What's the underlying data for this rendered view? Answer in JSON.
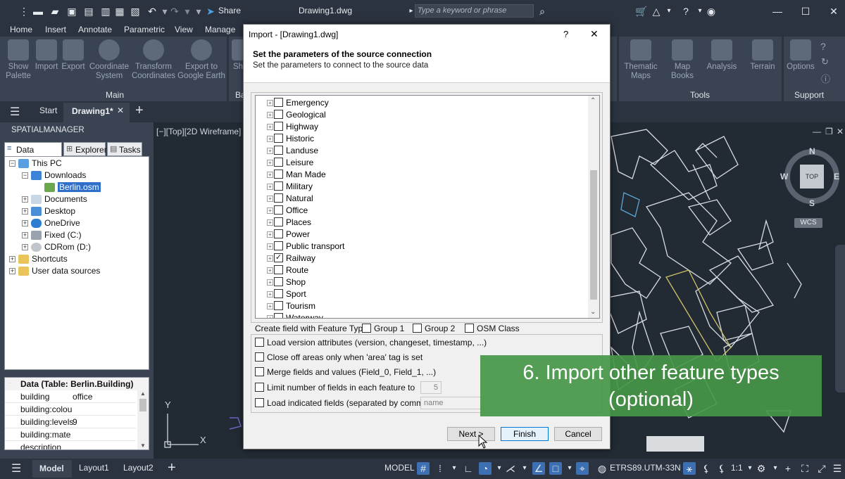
{
  "app": {
    "share_label": "Share",
    "doc_title": "Drawing1.dwg",
    "search_placeholder": "Type a keyword or phrase"
  },
  "menu": [
    "Home",
    "Insert",
    "Annotate",
    "Parametric",
    "View",
    "Manage"
  ],
  "ribbon": {
    "main_buttons": [
      {
        "label": "Show\nPalette",
        "icon": "spm-icon"
      },
      {
        "label": "Import",
        "icon": "import-icon"
      },
      {
        "label": "Export",
        "icon": "export-icon"
      },
      {
        "label": "Coordinate\nSystem",
        "icon": "globe-icon"
      },
      {
        "label": "Transform\nCoordinates",
        "icon": "transform-icon"
      },
      {
        "label": "Export to\nGoogle Earth",
        "icon": "google-earth-icon"
      }
    ],
    "partial_button": "Sh",
    "tools_buttons": [
      {
        "label": "Thematic\nMaps",
        "icon": "thematic-icon"
      },
      {
        "label": "Map\nBooks",
        "icon": "mapbook-icon"
      },
      {
        "label": "Analysis",
        "icon": "analysis-icon"
      },
      {
        "label": "Terrain",
        "icon": "terrain-icon"
      }
    ],
    "support_buttons": [
      {
        "label": "Options",
        "icon": "options-icon"
      }
    ],
    "group_main": "Main",
    "group_partial": "Ba",
    "group_tools": "Tools",
    "group_support": "Support"
  },
  "doc_tabs": {
    "start": "Start",
    "active": "Drawing1*"
  },
  "panel": {
    "title": "SPATIALMANAGER",
    "tabs": [
      "Data sources",
      "Explorer",
      "Tasks"
    ],
    "tree": [
      {
        "label": "This PC",
        "indent": 0,
        "icon": "pc"
      },
      {
        "label": "Downloads",
        "indent": 1,
        "icon": "download"
      },
      {
        "label": "Berlin.osm",
        "indent": 2,
        "icon": "osm",
        "selected": true
      },
      {
        "label": "Documents",
        "indent": 1,
        "icon": "doc"
      },
      {
        "label": "Desktop",
        "indent": 1,
        "icon": "desktop"
      },
      {
        "label": "OneDrive",
        "indent": 1,
        "icon": "cloud"
      },
      {
        "label": "Fixed (C:)",
        "indent": 1,
        "icon": "drive"
      },
      {
        "label": "CDRom (D:)",
        "indent": 1,
        "icon": "cd"
      },
      {
        "label": "Shortcuts",
        "indent": 0,
        "icon": "folder"
      },
      {
        "label": "User data sources",
        "indent": 0,
        "icon": "folder-user"
      }
    ],
    "data_header": "Data (Table: Berlin.Building)",
    "data_rows": [
      {
        "key": "building",
        "value": "office"
      },
      {
        "key": "building:colou",
        "value": ""
      },
      {
        "key": "building:levels",
        "value": "9"
      },
      {
        "key": "building:mate",
        "value": ""
      },
      {
        "key": "description",
        "value": ""
      }
    ]
  },
  "viewport": {
    "label": "[−][Top][2D Wireframe]",
    "compass": {
      "n": "N",
      "s": "S",
      "e": "E",
      "w": "W",
      "top": "TOP",
      "wcs": "WCS"
    },
    "axis_y": "Y",
    "axis_x": "X"
  },
  "dialog": {
    "title": "Import - [Drawing1.dwg]",
    "help": "?",
    "close": "✕",
    "heading": "Set the parameters of the source connection",
    "subheading": "Set the parameters to connect to the source data",
    "features": [
      {
        "label": "Emergency",
        "checked": false
      },
      {
        "label": "Geological",
        "checked": false
      },
      {
        "label": "Highway",
        "checked": false
      },
      {
        "label": "Historic",
        "checked": false
      },
      {
        "label": "Landuse",
        "checked": false
      },
      {
        "label": "Leisure",
        "checked": false
      },
      {
        "label": "Man Made",
        "checked": false
      },
      {
        "label": "Military",
        "checked": false
      },
      {
        "label": "Natural",
        "checked": false
      },
      {
        "label": "Office",
        "checked": false
      },
      {
        "label": "Places",
        "checked": false
      },
      {
        "label": "Power",
        "checked": false
      },
      {
        "label": "Public transport",
        "checked": false
      },
      {
        "label": "Railway",
        "checked": true
      },
      {
        "label": "Route",
        "checked": false
      },
      {
        "label": "Shop",
        "checked": false
      },
      {
        "label": "Sport",
        "checked": false
      },
      {
        "label": "Tourism",
        "checked": false
      },
      {
        "label": "Waterway",
        "checked": false
      }
    ],
    "create_field_label": "Create field with Feature Type",
    "group1": "Group 1",
    "group2": "Group 2",
    "osm_class": "OSM Class",
    "opt_version": "Load version attributes (version, changeset, timestamp, ...)",
    "opt_close": "Close off areas only when 'area' tag is set",
    "opt_merge": "Merge fields and values (Field_0, Field_1, ...)",
    "opt_limit": "Limit number of fields in each feature to",
    "limit_value": "5",
    "opt_indicated": "Load indicated fields (separated by commas)",
    "indicated_placeholder": "name",
    "btn_next": "Next >",
    "btn_finish": "Finish",
    "btn_cancel": "Cancel"
  },
  "caption": {
    "line1": "6. Import other feature types",
    "line2": "(optional)"
  },
  "status": {
    "model_tab": "Model",
    "layout1": "Layout1",
    "layout2": "Layout2",
    "model_button": "MODEL",
    "crs": "ETRS89.UTM-33N",
    "scale": "1:1"
  },
  "colors": {
    "accent": "#3d6fb3",
    "caption_bg": "#46964a",
    "drawing_lines": "#d8dde3"
  }
}
